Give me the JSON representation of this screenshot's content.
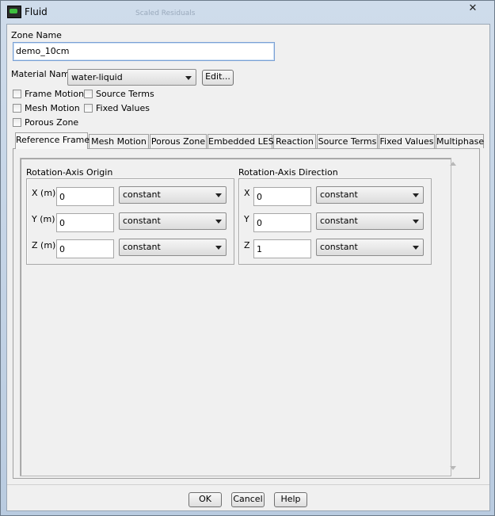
{
  "window": {
    "title": "Fluid",
    "ghost_text": "Scaled Residuals",
    "close_glyph": "✕"
  },
  "zone": {
    "label": "Zone Name",
    "value": "demo_10cm"
  },
  "material": {
    "label": "Material Name",
    "value": "water-liquid",
    "edit_label": "Edit..."
  },
  "options": {
    "frame_motion": "Frame Motion",
    "source_terms": "Source Terms",
    "mesh_motion": "Mesh Motion",
    "fixed_values": "Fixed Values",
    "porous_zone": "Porous Zone"
  },
  "tabs": [
    "Reference Frame",
    "Mesh Motion",
    "Porous Zone",
    "Embedded LES",
    "Reaction",
    "Source Terms",
    "Fixed Values",
    "Multiphase"
  ],
  "origin": {
    "title": "Rotation-Axis Origin",
    "rows": [
      {
        "label": "X (m)",
        "value": "0",
        "method": "constant"
      },
      {
        "label": "Y (m)",
        "value": "0",
        "method": "constant"
      },
      {
        "label": "Z (m)",
        "value": "0",
        "method": "constant"
      }
    ]
  },
  "direction": {
    "title": "Rotation-Axis Direction",
    "rows": [
      {
        "label": "X",
        "value": "0",
        "method": "constant"
      },
      {
        "label": "Y",
        "value": "0",
        "method": "constant"
      },
      {
        "label": "Z",
        "value": "1",
        "method": "constant"
      }
    ]
  },
  "buttons": {
    "ok": "OK",
    "cancel": "Cancel",
    "help": "Help"
  }
}
